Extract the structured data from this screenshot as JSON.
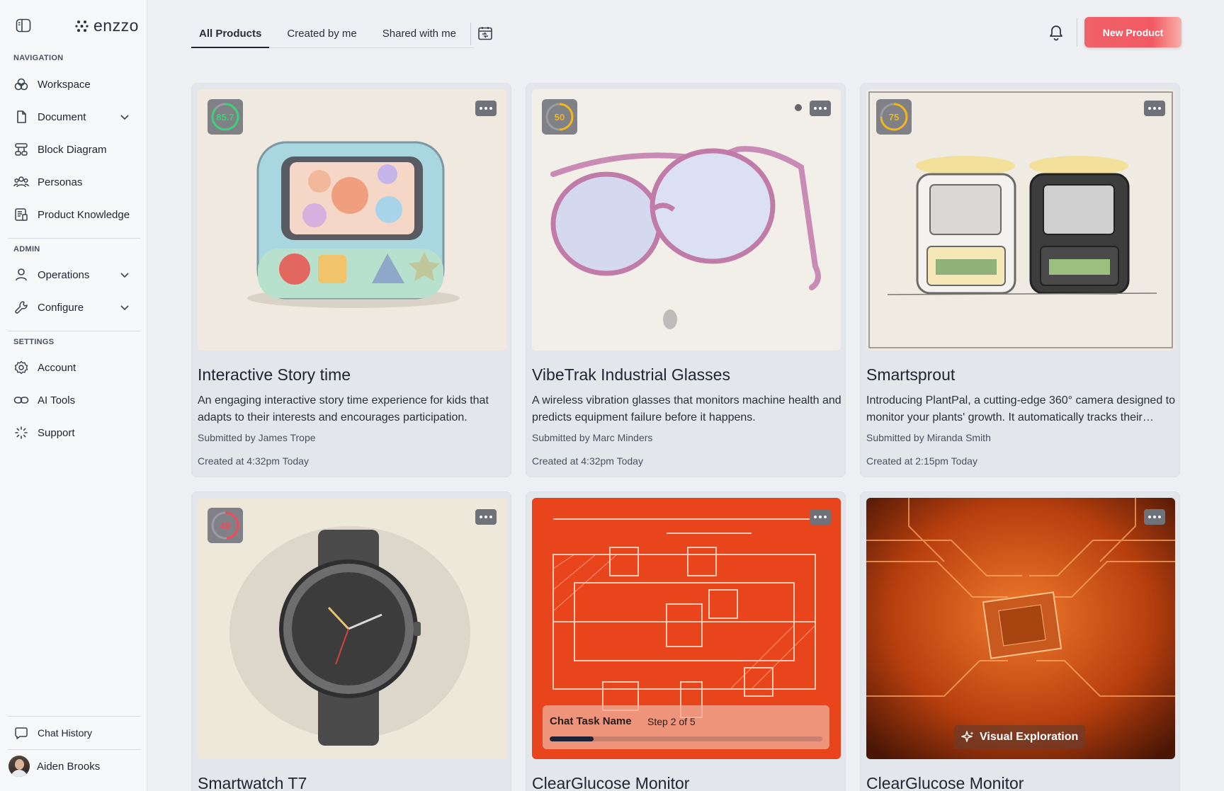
{
  "app": {
    "logo_text": "enzzo"
  },
  "sidebar": {
    "sections": {
      "navigation": "NAVIGATION",
      "admin": "ADMIN",
      "settings": "SETTINGS"
    },
    "items": [
      {
        "label": "Workspace",
        "icon": "workspace-icon"
      },
      {
        "label": "Document",
        "icon": "document-icon"
      },
      {
        "label": "Block Diagram",
        "icon": "block-diagram-icon"
      },
      {
        "label": "Personas",
        "icon": "personas-icon"
      },
      {
        "label": "Product Knowledge",
        "icon": "product-knowledge-icon"
      },
      {
        "label": "Operations",
        "icon": "user-icon"
      },
      {
        "label": "Configure",
        "icon": "wrench-icon"
      },
      {
        "label": "Account",
        "icon": "gear-icon"
      },
      {
        "label": "AI Tools",
        "icon": "link-icon"
      },
      {
        "label": "Support",
        "icon": "support-icon"
      }
    ],
    "chat_history": "Chat History",
    "user": {
      "name": "Aiden Brooks"
    }
  },
  "header": {
    "tabs": [
      "All Products",
      "Created by me",
      "Shared with me"
    ],
    "new_product": "New Product"
  },
  "products": [
    {
      "score": "85.7",
      "score_pct": 0.857,
      "score_color": "#3ecf7a",
      "title": "Interactive Story time",
      "description": "An engaging interactive story time experience for kids that adapts to their interests and encourages participation.",
      "submitted": "Submitted by James Trope",
      "created": "Created at 4:32pm Today"
    },
    {
      "score": "50",
      "score_pct": 0.5,
      "score_color": "#f2b51e",
      "title": "VibeTrak Industrial Glasses",
      "description": "A wireless vibration glasses that monitors machine health and predicts equipment failure before it happens.",
      "submitted": "Submitted by Marc Minders",
      "created": "Created at 4:32pm Today"
    },
    {
      "score": "75",
      "score_pct": 0.75,
      "score_color": "#f2b51e",
      "title": "Smartsprout",
      "description": "Introducing PlantPal, a cutting-edge 360° camera designed to monitor your plants' growth. It automatically tracks their health.",
      "submitted": "Submitted by Miranda Smith",
      "created": "Created at 2:15pm Today"
    },
    {
      "score": "48",
      "score_pct": 0.48,
      "score_color": "#ef4b5a",
      "title": "Smartwatch T7"
    },
    {
      "title": "ClearGlucose Monitor",
      "task": {
        "name": "Chat Task Name",
        "step": "Step 2 of 5",
        "progress": 0.16
      }
    },
    {
      "title": "ClearGlucose Monitor",
      "badge": "Visual Exploration"
    }
  ]
}
